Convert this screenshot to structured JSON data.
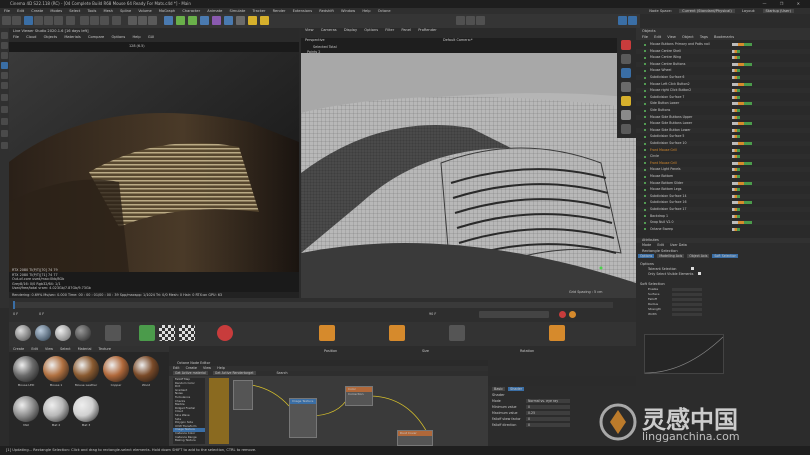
{
  "window": {
    "title": "Cinema 4D S22.118 (RC) - [04 Complete Build R68 Mouse 64 Ready For Mats.c4d *] - Main",
    "controls": "— ❐ ✕"
  },
  "menubar": {
    "items": [
      "File",
      "Edit",
      "Create",
      "Modes",
      "Select",
      "Tools",
      "Mesh",
      "Spline",
      "Volume",
      "MoGraph",
      "Character",
      "Animate",
      "Simulate",
      "Tracker",
      "Render",
      "Extensions",
      "Redshift",
      "Window",
      "Help",
      "Octane"
    ],
    "node_space_label": "Node Space:",
    "node_space_value": "Current (Standard/Physical)",
    "layout_label": "Layout:",
    "layout_value": "Startup (User)"
  },
  "viewport_left": {
    "title": "Live Viewer Studio 2020.1.6 [16 days left]",
    "menu": [
      "File",
      "Cloud",
      "Objects",
      "Materials",
      "Compare",
      "Options",
      "Help",
      "GUI"
    ],
    "zoom": "128 (6.5)",
    "stats": [
      "RTX 2080 TI(P/T)[?0] 74 79",
      "RTX 2080 TI(P/T)[?1] 74 77",
      "Out-of-core used/max:0kb/8Gb",
      "Grey8/16: 0/0 Rgb32/64: 1/1",
      "Used/free/total vram: 4.023Gb/7.87Gb/9.73Gb"
    ],
    "render_status": "Rendering: 0.69% Ms/sec: 0.000 Time: 00 : 00 : 01/00 : 00 : 39 Spp/maxspp: 1/1024 Tri: 0/0 Mesh: 0 Hair: 0 RTX:on GPU: 63"
  },
  "viewport_right": {
    "menu": [
      "View",
      "Cameras",
      "Display",
      "Options",
      "Filter",
      "Panel",
      "ProRender"
    ],
    "name": "Perspective",
    "camera": "Default Camera:*",
    "selected_total": "Selected Total",
    "points": "Points  2",
    "grid_spacing": "Grid Spacing : 5 cm"
  },
  "timeline": {
    "frame_start": "0 F",
    "frame_end": "90 F",
    "current": "0 F"
  },
  "material_manager": {
    "menu": [
      "Create",
      "Edit",
      "View",
      "Select",
      "Material",
      "Texture"
    ],
    "materials": [
      {
        "name": "Mouse LED",
        "color": "#6a6a6a"
      },
      {
        "name": "Mouse 1",
        "color": "#b07040"
      },
      {
        "name": "Mouse Leather",
        "color": "#8a5a30"
      },
      {
        "name": "Copper",
        "color": "#b0683a"
      },
      {
        "name": "Wood",
        "color": "#7a4a28"
      },
      {
        "name": "Mat",
        "color": "#909090"
      },
      {
        "name": "Mat 2",
        "color": "#b8b8b8"
      },
      {
        "name": "Mat 3",
        "color": "#d0d0d0"
      }
    ]
  },
  "coordinates": {
    "position_label": "Position",
    "size_label": "Size",
    "rotation_label": "Rotation"
  },
  "node_editor": {
    "title": "Octane Node Editor",
    "menu": [
      "Edit",
      "Create",
      "View",
      "Help"
    ],
    "tabs": [
      "Get Active material",
      "Get Active Rendertarget"
    ],
    "search_label": "Search",
    "nodes": [
      "Image Texture",
      "Color Correction",
      "Mix Texture",
      "Dust Cover"
    ],
    "list_items": [
      "Falloff Map",
      "Random Color",
      "Dirt",
      "Gradient",
      "Noise",
      "Turbulence",
      "Checks",
      "Marble",
      "Ridged Fractal",
      "Cloud",
      "Sine Wave",
      "Side",
      "Polygon Side",
      "UVW Transform",
      "Image Texture",
      "Instance Color",
      "Instance Range",
      "Baking Texture"
    ]
  },
  "node_attributes": {
    "tabs": [
      "Basic",
      "Shader"
    ],
    "section": "Shader",
    "rows": [
      {
        "label": "Mode",
        "value": "Normal vs. eye ray"
      },
      {
        "label": "Minimum value",
        "value": "0"
      },
      {
        "label": "Maximum value",
        "value": "0.25"
      },
      {
        "label": "Falloff skew factor",
        "value": "0"
      },
      {
        "label": "Falloff direction",
        "value": "0"
      }
    ]
  },
  "objects": {
    "menu": [
      "File",
      "Edit",
      "View",
      "Object",
      "Tags",
      "Bookmarks"
    ],
    "header": "Objects",
    "rows": [
      "Mouse Buttons Primary and Patts nail",
      "Mouse Centre Shell",
      "Mouse Centre Wing",
      "Mouse Centre Buttons",
      "Mouse Wheel",
      "Subdivision Surface 6",
      "Mouse Left Click Button2",
      "Mouse right Click Button2",
      "Subdivision Surface 7",
      "Side Button Lower",
      "Side Buttons",
      "Mouse Side Buttons Upper",
      "Mouse Side Buttons Lower",
      "Mouse Side Button Lower",
      "Subdivision Surface 5",
      "Subdivision Surface 10",
      "Front Mouse Grill",
      "Circle",
      "Front Mouse Grill",
      "Mouse Light Panels",
      "Mouse Bottom",
      "Mouse Bottom Slider",
      "Mouse Bottom Legs",
      "Subdivision Surface 14",
      "Subdivision Surface 16",
      "Subdivision Surface 17",
      "Backdrop 1",
      "Snap Null V2.0",
      "Octane Sweep"
    ]
  },
  "attributes": {
    "header": "Attributes",
    "menu": [
      "Mode",
      "Edit",
      "User Data"
    ],
    "tool": "Rectangle Selection",
    "tabs": [
      "Options",
      "Modelling Axis",
      "Object Axis",
      "Soft Selection"
    ],
    "options_title": "Options",
    "tolerant_selection": "Tolerant Selection",
    "only_visible": "Only Select Visible Elements",
    "soft_title": "Soft Selection",
    "soft_rows": [
      "Enable",
      "Surface",
      "Falloff",
      "Radius",
      "Strength",
      "Width"
    ],
    "preview": "Preview"
  },
  "status": {
    "text": "[1] Updating...      Rectangle Selection: Click and drag to rectangle-select elements. Hold down SHIFT to add to the selection, CTRL to remove."
  },
  "watermark": {
    "cn": "灵感中国",
    "en": "lingganchina.com"
  },
  "colors": {
    "accent_blue": "#3a6ea5",
    "selected_green": "#4b9b4b",
    "orange": "#d68a2c",
    "red": "#c83c3c"
  }
}
